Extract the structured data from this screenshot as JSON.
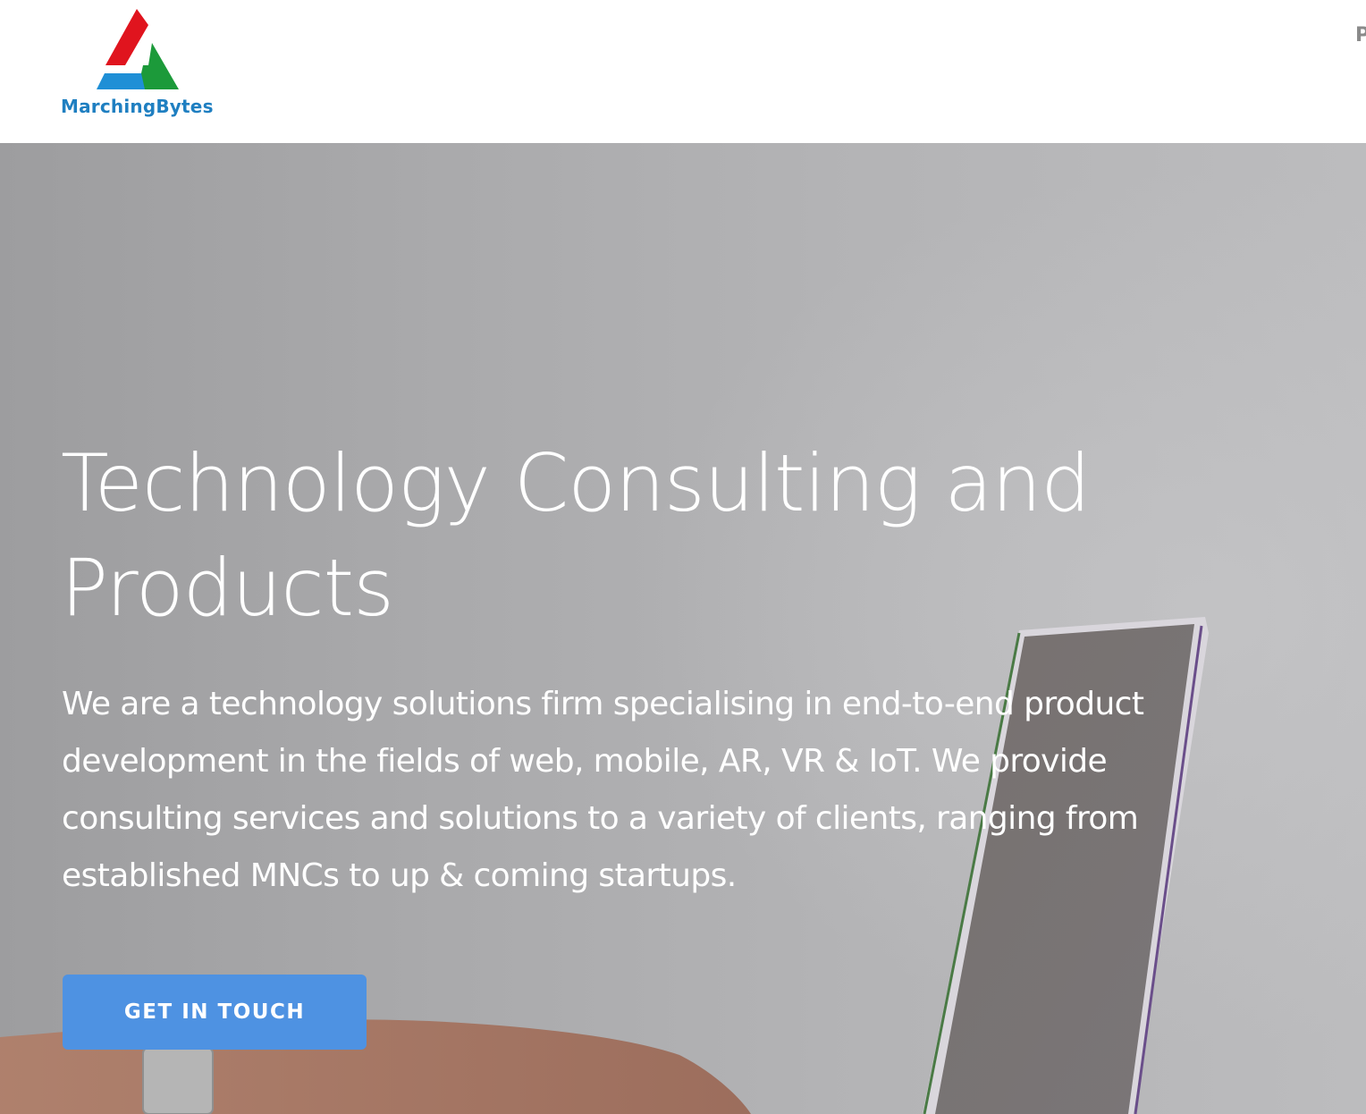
{
  "header": {
    "logo_text": "MarchingBytes",
    "nav_partial": "P"
  },
  "hero": {
    "title": "Technology Consulting and Products",
    "description": "We are a technology solutions firm specialising in end-to-end product development in the fields of web, mobile, AR, VR & IoT. We provide consulting services and solutions to a variety of clients, ranging from established MNCs to up & coming startups.",
    "cta_label": "GET IN TOUCH"
  },
  "colors": {
    "brand_blue": "#1f7fc1",
    "logo_red": "#e0141e",
    "logo_green": "#1c9a3a",
    "logo_blue": "#1f8fd6",
    "cta_blue": "#4e92e2"
  },
  "icons": {
    "logo": "marchingbytes-triangle-logo"
  }
}
